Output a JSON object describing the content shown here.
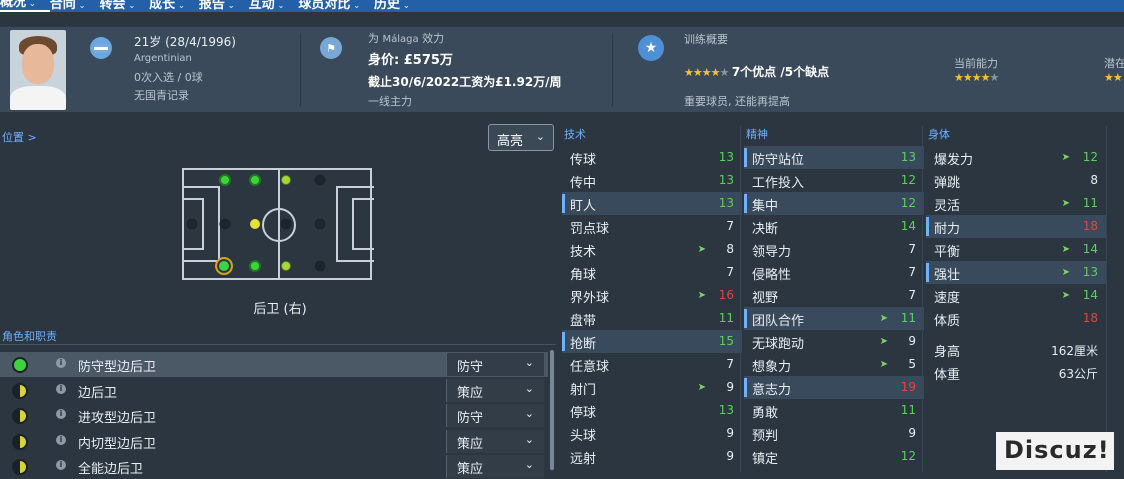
{
  "nav": [
    "概况",
    "合同",
    "转会",
    "成长",
    "报告",
    "互动",
    "球员对比",
    "历史"
  ],
  "header": {
    "age": "21岁 (28/4/1996)",
    "nationality": "Argentinian",
    "caps": "0次入选 / 0球",
    "youth": "无国青记录",
    "club_prefix": "为",
    "club": "Málaga",
    "club_suffix": "效力",
    "value": "身价: £575万",
    "contract": "截止30/6/2022工资为£1.92万/周",
    "squad_status": "一线主力",
    "training_title": "训练概要",
    "training_summary": "7个优点 /5个缺点",
    "training_note": "重要球员, 还能再提高",
    "current_ability_label": "当前能力",
    "potential_label": "潜在",
    "training_stars": 4,
    "current_stars": 4
  },
  "left": {
    "positions_link": "位置 >",
    "view_dropdown": "高亮",
    "position_label": "后卫 (右)",
    "roles_title": "角色和职责",
    "roles": [
      {
        "name": "防守型边后卫",
        "duty": "防守",
        "rating": "full"
      },
      {
        "name": "边后卫",
        "duty": "策应",
        "rating": "half"
      },
      {
        "name": "进攻型边后卫",
        "duty": "防守",
        "rating": "half"
      },
      {
        "name": "内切型边后卫",
        "duty": "策应",
        "rating": "half"
      },
      {
        "name": "全能边后卫",
        "duty": "策应",
        "rating": "half"
      }
    ]
  },
  "technical": {
    "title": "技术",
    "rows": [
      {
        "name": "传球",
        "value": "13",
        "color": "green"
      },
      {
        "name": "传中",
        "value": "13",
        "color": "green"
      },
      {
        "name": "盯人",
        "value": "13",
        "color": "green",
        "hl": true
      },
      {
        "name": "罚点球",
        "value": "7"
      },
      {
        "name": "技术",
        "value": "8",
        "arrow": true
      },
      {
        "name": "角球",
        "value": "7"
      },
      {
        "name": "界外球",
        "value": "16",
        "color": "red",
        "arrow": true
      },
      {
        "name": "盘带",
        "value": "11",
        "color": "green"
      },
      {
        "name": "抢断",
        "value": "15",
        "color": "green",
        "hl": true
      },
      {
        "name": "任意球",
        "value": "7"
      },
      {
        "name": "射门",
        "value": "9",
        "arrow": true
      },
      {
        "name": "停球",
        "value": "13",
        "color": "green"
      },
      {
        "name": "头球",
        "value": "9"
      },
      {
        "name": "远射",
        "value": "9"
      }
    ]
  },
  "mental": {
    "title": "精神",
    "rows": [
      {
        "name": "防守站位",
        "value": "13",
        "color": "green",
        "hl": true
      },
      {
        "name": "工作投入",
        "value": "12",
        "color": "green"
      },
      {
        "name": "集中",
        "value": "12",
        "color": "green",
        "hl": true
      },
      {
        "name": "决断",
        "value": "14",
        "color": "green"
      },
      {
        "name": "领导力",
        "value": "7"
      },
      {
        "name": "侵略性",
        "value": "7"
      },
      {
        "name": "视野",
        "value": "7"
      },
      {
        "name": "团队合作",
        "value": "11",
        "color": "green",
        "hl": true,
        "arrow": true
      },
      {
        "name": "无球跑动",
        "value": "9",
        "arrow": true
      },
      {
        "name": "想象力",
        "value": "5",
        "arrow": true
      },
      {
        "name": "意志力",
        "value": "19",
        "color": "red",
        "hl": true
      },
      {
        "name": "勇敢",
        "value": "11",
        "color": "green"
      },
      {
        "name": "预判",
        "value": "9"
      },
      {
        "name": "镇定",
        "value": "12",
        "color": "green"
      }
    ]
  },
  "physical": {
    "title": "身体",
    "rows": [
      {
        "name": "爆发力",
        "value": "12",
        "color": "green",
        "arrow": true
      },
      {
        "name": "弹跳",
        "value": "8"
      },
      {
        "name": "灵活",
        "value": "11",
        "color": "green",
        "arrow": true
      },
      {
        "name": "耐力",
        "value": "18",
        "color": "red",
        "hl": true
      },
      {
        "name": "平衡",
        "value": "14",
        "color": "green",
        "arrow": true
      },
      {
        "name": "强壮",
        "value": "13",
        "color": "green",
        "hl": true,
        "arrow": true
      },
      {
        "name": "速度",
        "value": "14",
        "color": "green",
        "arrow": true
      },
      {
        "name": "体质",
        "value": "18",
        "color": "red"
      }
    ],
    "height_label": "身高",
    "height": "162厘米",
    "weight_label": "体重",
    "weight": "63公斤"
  },
  "watermark": "Discuz!"
}
